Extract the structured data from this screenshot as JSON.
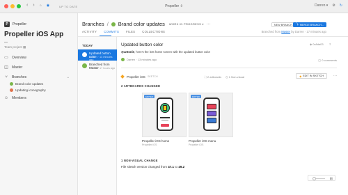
{
  "titlebar": {
    "status": "UP TO DATE",
    "title": "Propeller",
    "title_chevron": "⇳",
    "user": "Darren",
    "colors": {
      "red": "#ff5f57",
      "yellow": "#febc2e",
      "green": "#28c840"
    }
  },
  "sidebar": {
    "brand": "Propeller",
    "brand_initial": "P",
    "app_name": "Propeller iOS App",
    "team": "Team project ▦",
    "nav": [
      {
        "label": "Overview",
        "icon": "overview-icon"
      },
      {
        "label": "Master",
        "icon": "master-icon"
      },
      {
        "label": "Branches",
        "icon": "branch-icon"
      },
      {
        "label": "Members",
        "icon": "members-icon"
      }
    ],
    "branches": [
      {
        "label": "Brand color updates",
        "color": "#7ab648"
      },
      {
        "label": "Updating iconography",
        "color": "#e0734d"
      }
    ]
  },
  "header": {
    "crumb_root": "Branches",
    "crumb_sep": "/",
    "branch_name": "Brand color updates",
    "status_tag": "WORK IN PROGRESS ▾",
    "more": "···",
    "tabs": [
      "ACTIVITY",
      "COMMITS",
      "FILES",
      "COLLECTIONS"
    ],
    "new_branch": "NEW BRANCH...",
    "merge_branch": "MERGE BRANCH...",
    "branched_prefix": "Branched from ",
    "branched_link": "Master",
    "branched_suffix": " by Darren · 17 minutes ago"
  },
  "commits": {
    "group_label": "TODAY",
    "items": [
      {
        "title": "Updated button color",
        "sub": "Darren · 13 minutes ago"
      },
      {
        "title": "Branched from Master",
        "sub": "Darren · 17 hours ago"
      }
    ]
  },
  "detail": {
    "title": "Updated button color",
    "msg_user": "@antonie",
    "msg_text": ", here's the iOS home screen with the updated button color",
    "author": "Darren · 13 minutes ago",
    "hash": "0c8da03",
    "comments": "0 comments",
    "doc_name": "Propeller iOS",
    "doc_ver": "SKETCH",
    "artboards_count": "2 artboards",
    "new_count": "1 Non-visual",
    "edit_label": "EDIT IN SKETCH",
    "artboards_heading": "2 ARTBOARDS CHANGED",
    "artboards": [
      {
        "name": "Propeller iOS home",
        "sub": "Propeller iOS",
        "badge": "EDITED"
      },
      {
        "name": "Propeller iOS menu",
        "sub": "Propeller iOS",
        "badge": "EDITED"
      }
    ],
    "nonvisual_heading": "1 NON-VISUAL CHANGE",
    "nv_prefix": "File sketch version changed from ",
    "nv_from": "47.1",
    "nv_mid": " to ",
    "nv_to": "49.2"
  },
  "colors": {
    "accent": "#1b78e0",
    "warn": "#f5a623"
  }
}
